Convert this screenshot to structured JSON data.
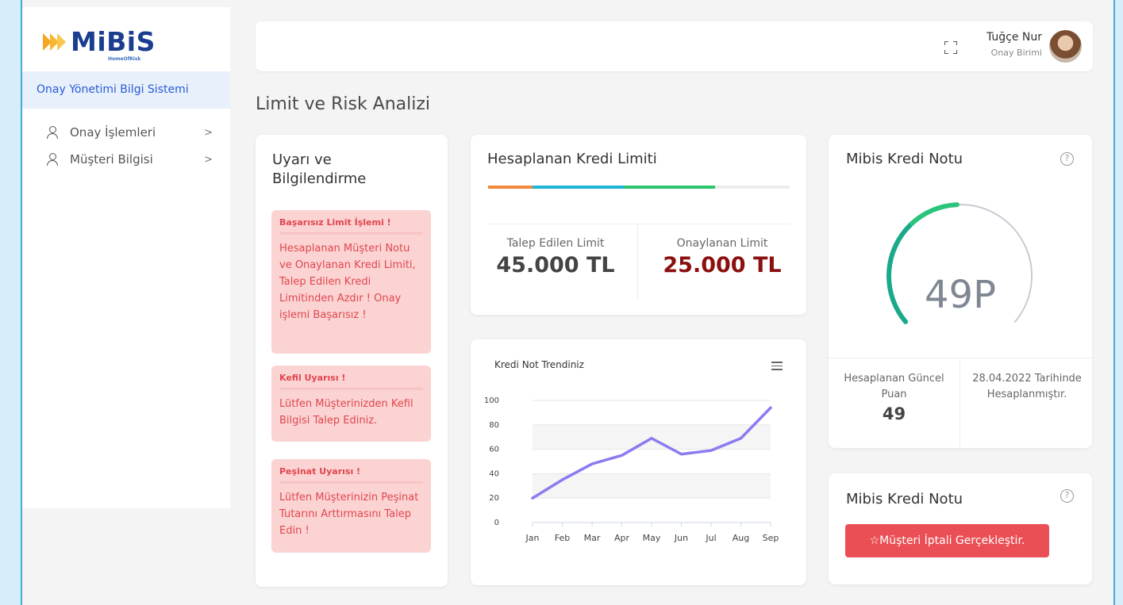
{
  "sidebar": {
    "logo": {
      "brand": "MiBiS",
      "sub": "HomeOfRisk"
    },
    "system_title": "Onay Yönetimi Bilgi Sistemi",
    "items": [
      {
        "label": "Onay İşlemleri",
        "icon": "user-icon",
        "arrow": ">"
      },
      {
        "label": "Müşteri Bilgisi",
        "icon": "user-icon",
        "arrow": ">"
      }
    ]
  },
  "header": {
    "user_name": "Tuğçe Nur",
    "user_role": "Onay Birimi"
  },
  "page": {
    "title": "Limit ve Risk Analizi"
  },
  "warnings": {
    "title": "Uyarı ve Bilgilendirme",
    "items": [
      {
        "title": "Başarısız Limit İşlemi !",
        "body": "Hesaplanan Müşteri Notu ve Onaylanan Kredi Limiti, Talep Edilen Kredi Limitinden Azdır ! Onay işlemi Başarısız !"
      },
      {
        "title": "Kefil Uyarısı !",
        "body": "Lütfen Müşterinizden Kefil Bilgisi Talep Ediniz."
      },
      {
        "title": "Peşinat Uyarısı !",
        "body": "Lütfen Müşterinizin Peşinat Tutarını Arttırmasını Talep Edin !"
      }
    ]
  },
  "limit": {
    "title": "Hesaplanan Kredi Limiti",
    "progress_colors": [
      "#f08a3a",
      "#1fb6d6",
      "#2ec46b"
    ],
    "requested_label": "Talep Edilen Limit",
    "requested_value": "45.000 TL",
    "approved_label": "Onaylanan Limit",
    "approved_value": "25.000 TL",
    "approved_color": "#8b0f0f"
  },
  "score": {
    "title": "Mibis Kredi Notu",
    "value_text": "49P",
    "value": 49,
    "arc_colors": [
      "#1aa98a",
      "#2bc47b",
      "#c7ccd4"
    ],
    "calc_label": "Hesaplanan Güncel Puan",
    "calc_value": "49",
    "date_text": "28.04.2022 Tarihinde Hesaplanmıştır."
  },
  "cancel_card": {
    "title": "Mibis Kredi Notu",
    "button_label": "☆Müşteri İptali Gerçekleştir."
  },
  "chart_data": {
    "type": "line",
    "title": "Kredi Not Trendiniz",
    "categories": [
      "Jan",
      "Feb",
      "Mar",
      "Apr",
      "May",
      "Jun",
      "Jul",
      "Aug",
      "Sep"
    ],
    "values": [
      20,
      35,
      48,
      55,
      69,
      56,
      59,
      69,
      94
    ],
    "ylim": [
      0,
      100
    ],
    "yticks": [
      0,
      20,
      40,
      60,
      80,
      100
    ],
    "color": "#8a7cf0",
    "grid": true
  }
}
